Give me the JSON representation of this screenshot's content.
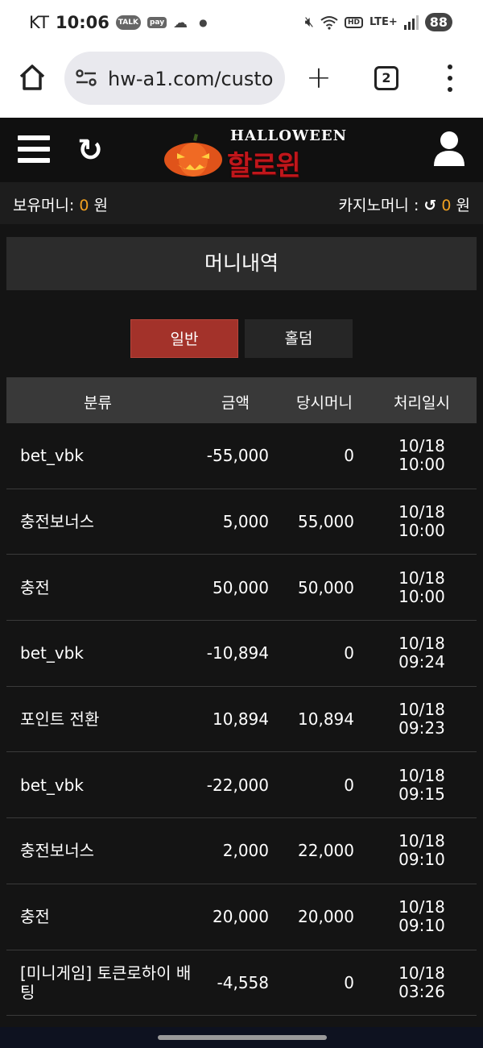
{
  "status_bar": {
    "carrier": "KT",
    "time": "10:06",
    "talk_badge": "TALK",
    "pay_badge": "pay",
    "lte": "LTE+",
    "hd": "HD",
    "battery": "88"
  },
  "browser": {
    "url": "hw-a1.com/custo",
    "tab_count": "2"
  },
  "site": {
    "logo_en": "HALLOWEEN",
    "logo_ko": "할로윈"
  },
  "balance": {
    "held_label": "보유머니:",
    "held_value": "0",
    "held_unit": "원",
    "casino_label": "카지노머니 :",
    "casino_value": "0",
    "casino_unit": "원"
  },
  "page_title": "머니내역",
  "tabs": {
    "general": "일반",
    "holdem": "홀덤"
  },
  "table": {
    "headers": [
      "분류",
      "금액",
      "당시머니",
      "처리일시"
    ],
    "rows": [
      {
        "category": "bet_vbk",
        "amount": "-55,000",
        "balance": "0",
        "date": "10/18",
        "time": "10:00"
      },
      {
        "category": "충전보너스",
        "amount": "5,000",
        "balance": "55,000",
        "date": "10/18",
        "time": "10:00"
      },
      {
        "category": "충전",
        "amount": "50,000",
        "balance": "50,000",
        "date": "10/18",
        "time": "10:00"
      },
      {
        "category": "bet_vbk",
        "amount": "-10,894",
        "balance": "0",
        "date": "10/18",
        "time": "09:24"
      },
      {
        "category": "포인트 전환",
        "amount": "10,894",
        "balance": "10,894",
        "date": "10/18",
        "time": "09:23"
      },
      {
        "category": "bet_vbk",
        "amount": "-22,000",
        "balance": "0",
        "date": "10/18",
        "time": "09:15"
      },
      {
        "category": "충전보너스",
        "amount": "2,000",
        "balance": "22,000",
        "date": "10/18",
        "time": "09:10"
      },
      {
        "category": "충전",
        "amount": "20,000",
        "balance": "20,000",
        "date": "10/18",
        "time": "09:10"
      },
      {
        "category": "[미니게임] 토큰로하이 배팅",
        "amount": "-4,558",
        "balance": "0",
        "date": "10/18",
        "time": "03:26"
      }
    ]
  },
  "colors": {
    "accent_orange": "#f0a020",
    "active_tab": "#a3322a",
    "background": "#141414"
  }
}
